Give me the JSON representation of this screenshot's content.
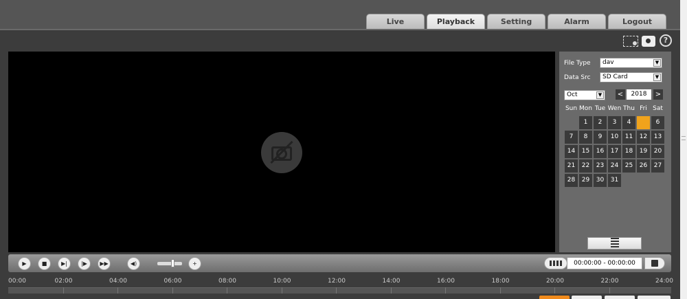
{
  "tabs": [
    {
      "label": "Live",
      "active": false
    },
    {
      "label": "Playback",
      "active": true
    },
    {
      "label": "Setting",
      "active": false
    },
    {
      "label": "Alarm",
      "active": false
    },
    {
      "label": "Logout",
      "active": false
    }
  ],
  "toolbar": {
    "help_label": "?"
  },
  "search": {
    "file_type_label": "File Type",
    "file_type_value": "dav",
    "data_src_label": "Data Src",
    "data_src_value": "SD Card",
    "month_value": "Oct",
    "year_value": "2018",
    "prev_label": "<",
    "next_label": ">"
  },
  "calendar": {
    "weekdays": [
      "Sun",
      "Mon",
      "Tue",
      "Wen",
      "Thu",
      "Fri",
      "Sat"
    ],
    "first_weekday_index": 1,
    "days_in_month": 31,
    "today": 5
  },
  "controls": {
    "time_range": "00:00:00 - 00:00:00"
  },
  "timeline": {
    "ticks": [
      "00:00",
      "02:00",
      "04:00",
      "06:00",
      "08:00",
      "10:00",
      "12:00",
      "14:00",
      "16:00",
      "18:00",
      "20:00",
      "22:00",
      "24:00"
    ]
  },
  "colors": {
    "accent": "#f0a31c",
    "background": "#3c3c3c",
    "sidebar": "#6a6a6a"
  }
}
